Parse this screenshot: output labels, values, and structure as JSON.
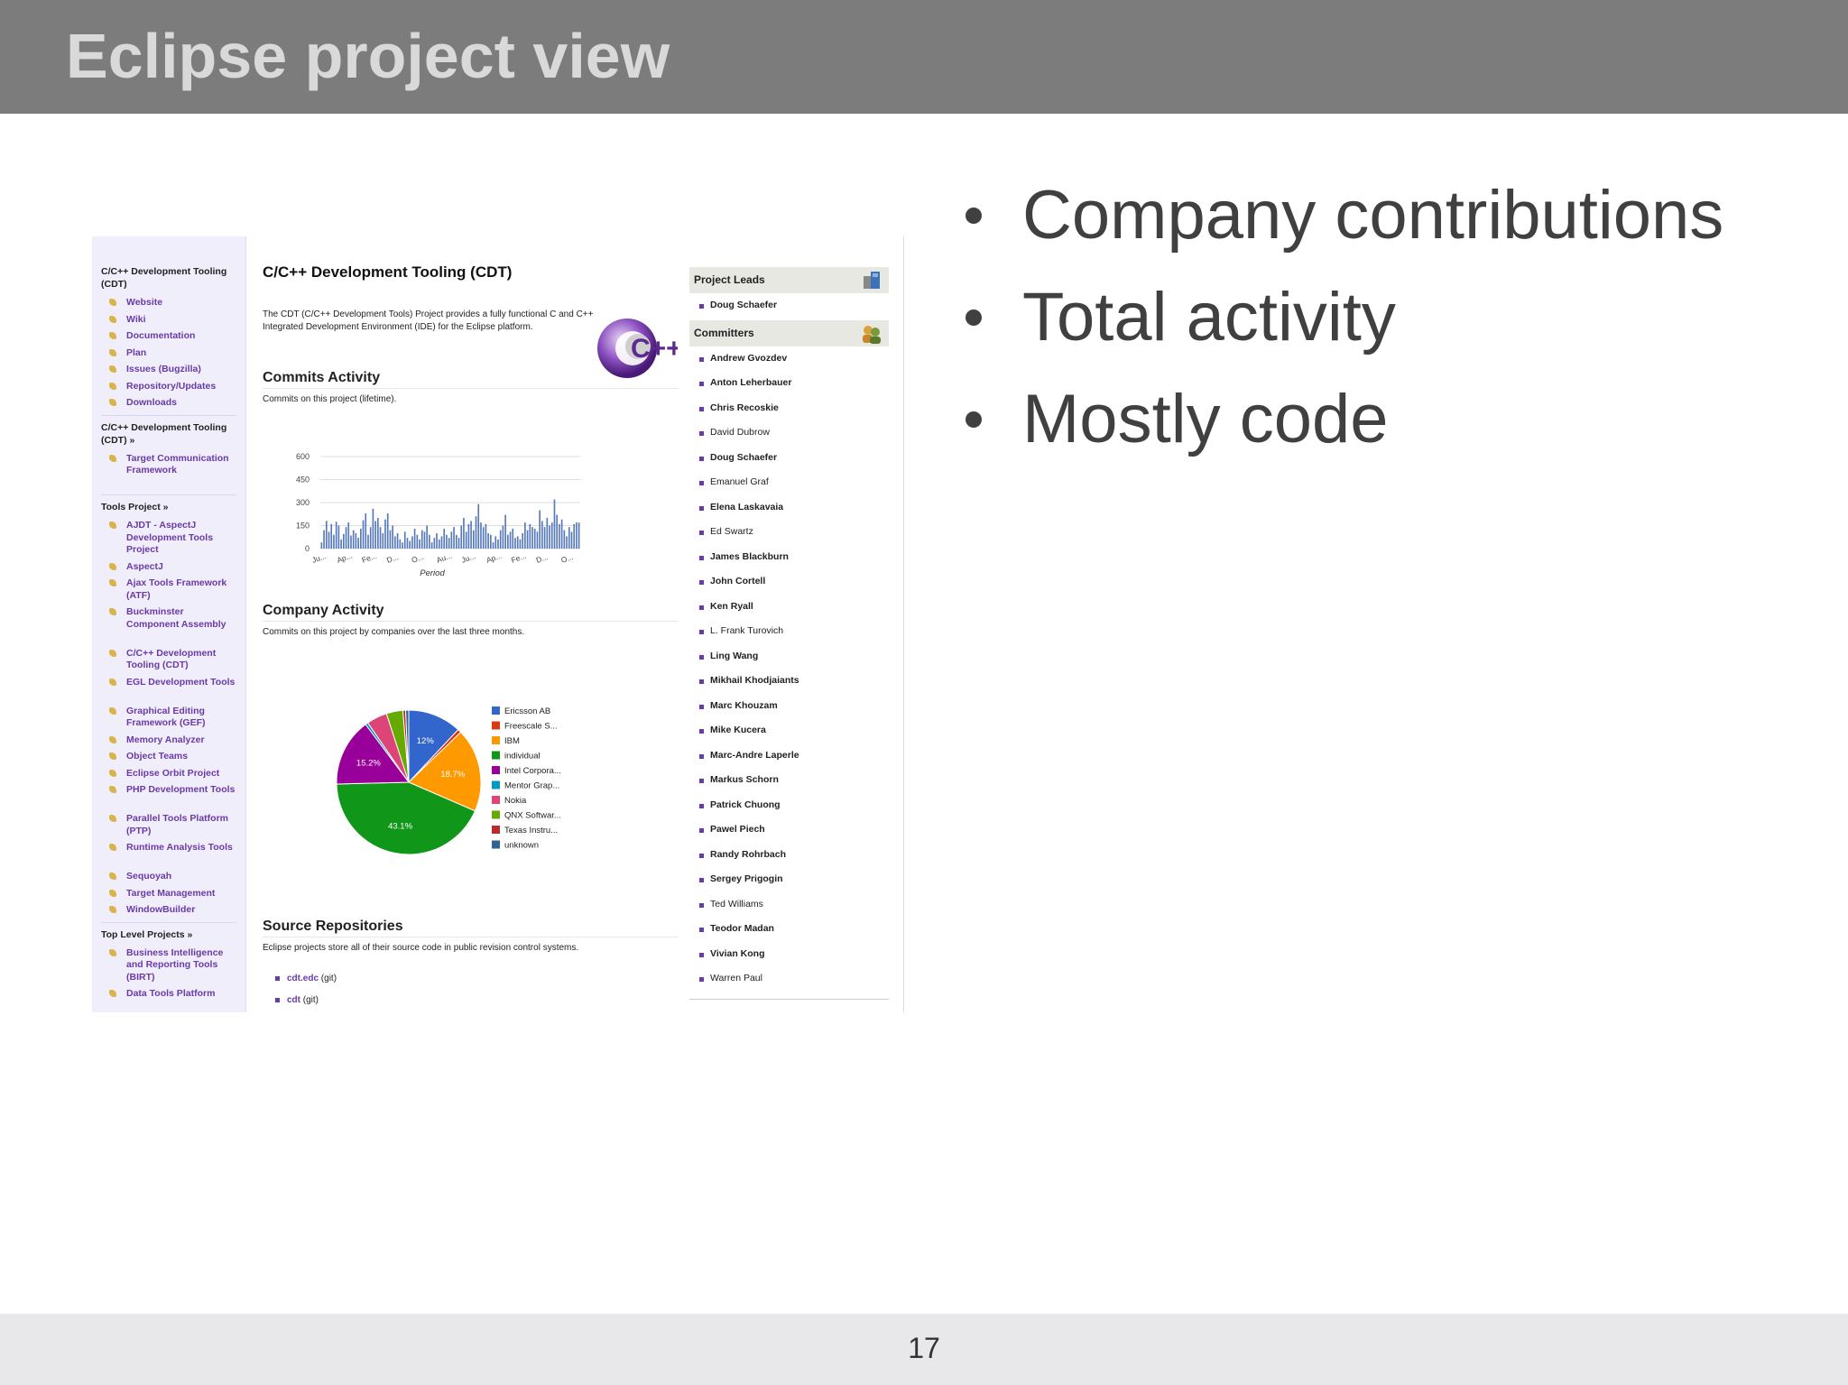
{
  "slide": {
    "title": "Eclipse project view",
    "page_number": "17",
    "bullets": [
      "Company contributions",
      "Total activity",
      "Mostly code"
    ]
  },
  "left_nav": {
    "group1_title": "C/C++ Development Tooling (CDT)",
    "group1_items": [
      "Website",
      "Wiki",
      "Documentation",
      "Plan",
      "Issues (Bugzilla)",
      "Repository/Updates",
      "Downloads"
    ],
    "group2_title": "C/C++ Development Tooling (CDT) »",
    "group2_items": [
      "Target Communication Framework"
    ],
    "group3_title": "Tools Project »",
    "group3_items": [
      "AJDT - AspectJ Development Tools Project",
      "AspectJ",
      "Ajax Tools Framework (ATF)",
      "Buckminster Component Assembly",
      "C/C++ Development Tooling (CDT)",
      "EGL Development Tools",
      "Graphical Editing Framework (GEF)",
      "Memory Analyzer",
      "Object Teams",
      "Eclipse Orbit Project",
      "PHP Development Tools",
      "Parallel Tools Platform (PTP)",
      "Runtime Analysis Tools",
      "Sequoyah",
      "Target Management",
      "WindowBuilder"
    ],
    "group4_title": "Top Level Projects »",
    "group4_items": [
      "Business Intelligence and Reporting Tools (BIRT)",
      "Data Tools Platform"
    ]
  },
  "main": {
    "title": "C/C++ Development Tooling (CDT)",
    "description": "The CDT (C/C++ Development Tools) Project provides a fully functional C and C++ Integrated Development Environment (IDE) for the Eclipse platform.",
    "logo_text": "C++",
    "commits_title": "Commits Activity",
    "commits_sub": "Commits on this project (lifetime).",
    "company_title": "Company Activity",
    "company_sub": "Commits on this project by companies over the last three months.",
    "source_title": "Source Repositories",
    "source_sub": "Eclipse projects store all of their source code in public revision control systems.",
    "repos": [
      {
        "name": "cdt.edc",
        "type": "(git)"
      },
      {
        "name": "cdt",
        "type": "(git)"
      }
    ]
  },
  "chart_data": [
    {
      "type": "bar",
      "title": "",
      "xlabel": "Period",
      "ylabel": "",
      "ylim": [
        0,
        600
      ],
      "yticks": [
        "600",
        "450",
        "300",
        "150",
        "0"
      ],
      "xticks": [
        "Ju...",
        "Ap...",
        "Fe...",
        "D...",
        "O...",
        "Au...",
        "Ju...",
        "Ap...",
        "Fe...",
        "D...",
        "O..."
      ],
      "values": [
        40,
        120,
        180,
        110,
        160,
        90,
        175,
        150,
        60,
        95,
        140,
        170,
        85,
        120,
        100,
        70,
        130,
        185,
        230,
        90,
        140,
        260,
        180,
        200,
        140,
        100,
        190,
        230,
        120,
        150,
        80,
        100,
        60,
        40,
        110,
        70,
        50,
        80,
        130,
        90,
        60,
        120,
        110,
        150,
        90,
        40,
        70,
        100,
        60,
        80,
        130,
        90,
        70,
        110,
        140,
        90,
        70,
        150,
        200,
        110,
        160,
        180,
        120,
        210,
        290,
        170,
        140,
        160,
        100,
        90,
        40,
        80,
        60,
        120,
        150,
        220,
        90,
        110,
        130,
        70,
        80,
        60,
        100,
        170,
        120,
        160,
        140,
        130,
        110,
        250,
        180,
        140,
        200,
        150,
        170,
        320,
        220,
        160,
        190,
        120,
        80,
        140,
        110,
        160,
        170,
        170
      ]
    },
    {
      "type": "pie",
      "title": "",
      "legend": [
        "Ericsson AB",
        "Freescale S...",
        "IBM",
        "individual",
        "Intel Corpora...",
        "Mentor Grap...",
        "Nokia",
        "QNX Softwar...",
        "Texas Instru...",
        "unknown"
      ],
      "colors": [
        "#3366cc",
        "#dc3912",
        "#ff9900",
        "#109618",
        "#990099",
        "#0099c6",
        "#dd4477",
        "#66aa00",
        "#b82e2e",
        "#316395"
      ],
      "values": [
        12.0,
        0.8,
        18.7,
        43.1,
        15.2,
        0.6,
        4.6,
        3.7,
        0.6,
        0.7
      ],
      "slice_labels": [
        "12%",
        "",
        "18.7%",
        "43.1%",
        "15.2%",
        "",
        "",
        "",
        "",
        ""
      ]
    }
  ],
  "right": {
    "leads_title": "Project Leads",
    "leads": [
      {
        "name": "Doug Schaefer",
        "bold": true
      }
    ],
    "committers_title": "Committers",
    "committers": [
      {
        "name": "Andrew Gvozdev",
        "bold": true
      },
      {
        "name": "Anton Leherbauer",
        "bold": true
      },
      {
        "name": "Chris Recoskie",
        "bold": true
      },
      {
        "name": "David Dubrow",
        "bold": false
      },
      {
        "name": "Doug Schaefer",
        "bold": true
      },
      {
        "name": "Emanuel Graf",
        "bold": false
      },
      {
        "name": "Elena Laskavaia",
        "bold": true
      },
      {
        "name": "Ed Swartz",
        "bold": false
      },
      {
        "name": "James Blackburn",
        "bold": true
      },
      {
        "name": "John Cortell",
        "bold": true
      },
      {
        "name": "Ken Ryall",
        "bold": true
      },
      {
        "name": "L. Frank Turovich",
        "bold": false
      },
      {
        "name": "Ling Wang",
        "bold": true
      },
      {
        "name": "Mikhail Khodjaiants",
        "bold": true
      },
      {
        "name": "Marc Khouzam",
        "bold": true
      },
      {
        "name": "Mike Kucera",
        "bold": true
      },
      {
        "name": "Marc-Andre Laperle",
        "bold": true
      },
      {
        "name": "Markus Schorn",
        "bold": true
      },
      {
        "name": "Patrick Chuong",
        "bold": true
      },
      {
        "name": "Pawel Piech",
        "bold": true
      },
      {
        "name": "Randy Rohrbach",
        "bold": true
      },
      {
        "name": "Sergey Prigogin",
        "bold": true
      },
      {
        "name": "Ted Williams",
        "bold": false
      },
      {
        "name": "Teodor Madan",
        "bold": true
      },
      {
        "name": "Vivian Kong",
        "bold": true
      },
      {
        "name": "Warren Paul",
        "bold": false
      }
    ]
  }
}
